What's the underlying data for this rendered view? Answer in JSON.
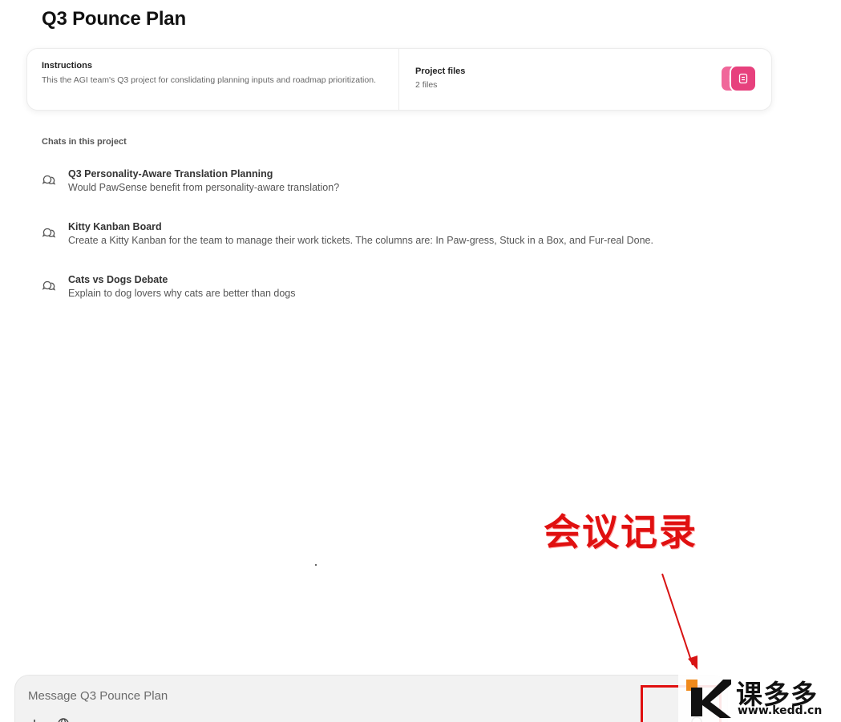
{
  "page": {
    "title": "Q3 Pounce Plan"
  },
  "instructions": {
    "heading": "Instructions",
    "text": "This the AGI team's Q3 project for conslidating planning inputs and roadmap prioritization."
  },
  "project_files": {
    "heading": "Project files",
    "count": "2 files",
    "icons": [
      "document-icon",
      "document-icon"
    ],
    "accent": "#e7417d"
  },
  "chats": {
    "label": "Chats in this project",
    "items": [
      {
        "title": "Q3 Personality-Aware Translation Planning",
        "subtitle": "Would PawSense benefit from personality-aware translation?"
      },
      {
        "title": "Kitty Kanban Board",
        "subtitle": "Create a Kitty Kanban for the team to manage their work tickets. The columns are: In Paw-gress, Stuck in a Box, and Fur-real Done."
      },
      {
        "title": "Cats vs Dogs Debate",
        "subtitle": "Explain to dog lovers why cats are better than dogs"
      }
    ]
  },
  "composer": {
    "placeholder": "Message Q3 Pounce Plan",
    "icons": [
      "attach-icon",
      "globe-icon",
      "tool-icon",
      "user-icon"
    ]
  },
  "annotation": {
    "text": "会议记录",
    "color": "#e01010"
  },
  "watermark": {
    "title": "课多多",
    "url": "www.kedd.cn",
    "accent": "#f08a1c"
  }
}
